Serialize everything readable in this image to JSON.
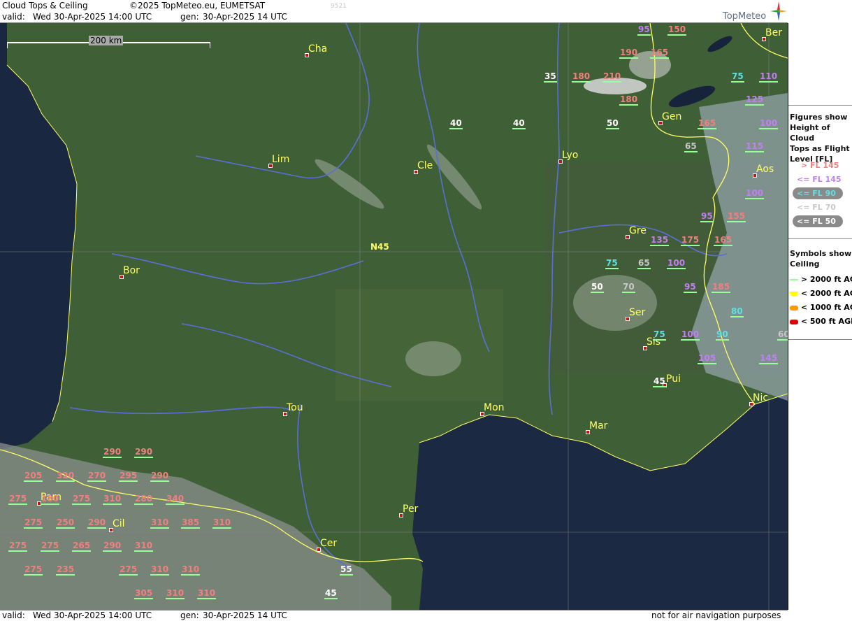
{
  "header": {
    "title": "Cloud Tops & Ceiling",
    "copyright": "©2025 TopMeteo.eu, EUMETSAT",
    "image_code": "9521",
    "valid_label": "valid:",
    "valid_value": "Wed  30-Apr-2025  14:00 UTC",
    "gen_label": "gen:",
    "gen_value": "30-Apr-2025 14 UTC",
    "brand": "TopMeteo"
  },
  "footer": {
    "valid_label": "valid:",
    "valid_value": "Wed  30-Apr-2025  14:00 UTC",
    "gen_label": "gen:",
    "gen_value": "30-Apr-2025 14 UTC",
    "disclaimer": "not for air navigation purposes"
  },
  "map": {
    "scale_label": "200 km",
    "latitude_label": "N45",
    "colors": {
      "land": "#3f5f36",
      "sea": "#1a2740",
      "river": "#5a6fd8",
      "border": "#ffff66"
    },
    "cities": [
      {
        "name": "Cha"
      },
      {
        "name": "Lim"
      },
      {
        "name": "Cle"
      },
      {
        "name": "Lyo"
      },
      {
        "name": "Gen"
      },
      {
        "name": "Ber"
      },
      {
        "name": "Aos"
      },
      {
        "name": "Gre"
      },
      {
        "name": "Bor"
      },
      {
        "name": "Ser"
      },
      {
        "name": "Sis"
      },
      {
        "name": "Pui"
      },
      {
        "name": "Nic"
      },
      {
        "name": "Tou"
      },
      {
        "name": "Mon"
      },
      {
        "name": "Mar"
      },
      {
        "name": "Per"
      },
      {
        "name": "Pam"
      },
      {
        "name": "Cil"
      },
      {
        "name": "Cer"
      }
    ],
    "cloud_tops": [
      {
        "v": "95",
        "cat": "mid"
      },
      {
        "v": "150",
        "cat": "hi"
      },
      {
        "v": "190",
        "cat": "hi"
      },
      {
        "v": "165",
        "cat": "hi"
      },
      {
        "v": "35",
        "cat": "50"
      },
      {
        "v": "180",
        "cat": "hi"
      },
      {
        "v": "210",
        "cat": "hi"
      },
      {
        "v": "180",
        "cat": "hi"
      },
      {
        "v": "75",
        "cat": "90"
      },
      {
        "v": "110",
        "cat": "mid"
      },
      {
        "v": "125",
        "cat": "mid"
      },
      {
        "v": "40",
        "cat": "50"
      },
      {
        "v": "40",
        "cat": "50"
      },
      {
        "v": "50",
        "cat": "50"
      },
      {
        "v": "165",
        "cat": "hi"
      },
      {
        "v": "100",
        "cat": "mid"
      },
      {
        "v": "65",
        "cat": "70"
      },
      {
        "v": "115",
        "cat": "mid"
      },
      {
        "v": "100",
        "cat": "mid"
      },
      {
        "v": "95",
        "cat": "mid"
      },
      {
        "v": "155",
        "cat": "hi"
      },
      {
        "v": "135",
        "cat": "mid"
      },
      {
        "v": "175",
        "cat": "hi"
      },
      {
        "v": "165",
        "cat": "hi"
      },
      {
        "v": "75",
        "cat": "90"
      },
      {
        "v": "65",
        "cat": "70"
      },
      {
        "v": "100",
        "cat": "mid"
      },
      {
        "v": "50",
        "cat": "50"
      },
      {
        "v": "70",
        "cat": "70"
      },
      {
        "v": "95",
        "cat": "mid"
      },
      {
        "v": "185",
        "cat": "hi"
      },
      {
        "v": "80",
        "cat": "90"
      },
      {
        "v": "75",
        "cat": "90"
      },
      {
        "v": "100",
        "cat": "mid"
      },
      {
        "v": "90",
        "cat": "90"
      },
      {
        "v": "60",
        "cat": "70"
      },
      {
        "v": "105",
        "cat": "mid"
      },
      {
        "v": "145",
        "cat": "mid"
      },
      {
        "v": "45",
        "cat": "50"
      },
      {
        "v": "290",
        "cat": "hi"
      },
      {
        "v": "290",
        "cat": "hi"
      },
      {
        "v": "205",
        "cat": "hi"
      },
      {
        "v": "320",
        "cat": "hi"
      },
      {
        "v": "270",
        "cat": "hi"
      },
      {
        "v": "295",
        "cat": "hi"
      },
      {
        "v": "290",
        "cat": "hi"
      },
      {
        "v": "275",
        "cat": "hi"
      },
      {
        "v": "180",
        "cat": "hi"
      },
      {
        "v": "275",
        "cat": "hi"
      },
      {
        "v": "310",
        "cat": "hi"
      },
      {
        "v": "280",
        "cat": "hi"
      },
      {
        "v": "340",
        "cat": "hi"
      },
      {
        "v": "275",
        "cat": "hi"
      },
      {
        "v": "250",
        "cat": "hi"
      },
      {
        "v": "290",
        "cat": "hi"
      },
      {
        "v": "310",
        "cat": "hi"
      },
      {
        "v": "385",
        "cat": "hi"
      },
      {
        "v": "310",
        "cat": "hi"
      },
      {
        "v": "275",
        "cat": "hi"
      },
      {
        "v": "275",
        "cat": "hi"
      },
      {
        "v": "265",
        "cat": "hi"
      },
      {
        "v": "290",
        "cat": "hi"
      },
      {
        "v": "310",
        "cat": "hi"
      },
      {
        "v": "275",
        "cat": "hi"
      },
      {
        "v": "235",
        "cat": "hi"
      },
      {
        "v": "275",
        "cat": "hi"
      },
      {
        "v": "310",
        "cat": "hi"
      },
      {
        "v": "310",
        "cat": "hi"
      },
      {
        "v": "305",
        "cat": "hi"
      },
      {
        "v": "310",
        "cat": "hi"
      },
      {
        "v": "310",
        "cat": "hi"
      },
      {
        "v": "55",
        "cat": "50"
      },
      {
        "v": "45",
        "cat": "50"
      }
    ]
  },
  "legend": {
    "figures_title": "Figures show Height of Cloud Tops as Flight Level  [FL]",
    "figures_lines": [
      "Figures show",
      "Height of Cloud",
      "Tops as Flight",
      "Level  [FL]"
    ],
    "levels": [
      {
        "label": "> FL 145",
        "color": "#f08080"
      },
      {
        "label": "<= FL 145",
        "color": "#c080f0"
      },
      {
        "label": "<= FL 90",
        "color": "#60e0e0"
      },
      {
        "label": "<= FL 70",
        "color": "#c8c8c8"
      },
      {
        "label": "<= FL 50",
        "color": "#ffffff"
      }
    ],
    "symbols_lines": [
      "Symbols show",
      "Ceiling"
    ],
    "symbols": [
      {
        "label": "> 2000 ft AGL",
        "color": "#99ff99"
      },
      {
        "label": "< 2000 ft AGL",
        "color": "#ffff00"
      },
      {
        "label": "< 1000 ft AGL",
        "color": "#ff9900"
      },
      {
        "label": "< 500 ft AGL",
        "color": "#dd0000"
      }
    ]
  }
}
